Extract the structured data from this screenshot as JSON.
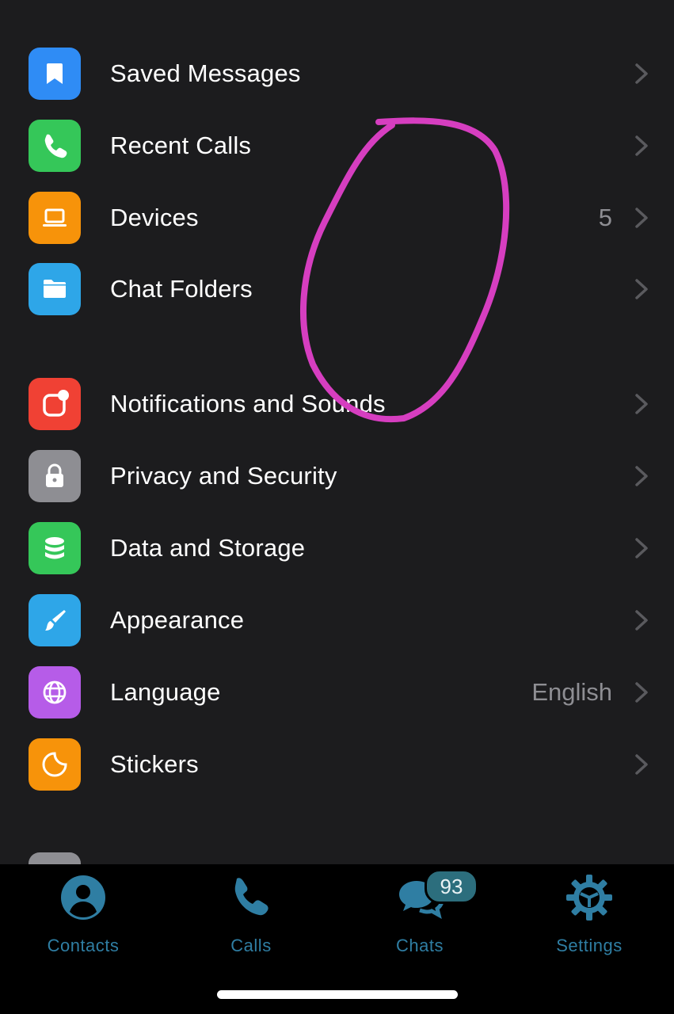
{
  "settings_list": {
    "group1": [
      {
        "label": "Saved Messages",
        "value": "",
        "icon": "bookmark-icon",
        "color": "#2f8cf5"
      },
      {
        "label": "Recent Calls",
        "value": "",
        "icon": "phone-icon",
        "color": "#35c759"
      },
      {
        "label": "Devices",
        "value": "5",
        "icon": "laptop-icon",
        "color": "#f7930a"
      },
      {
        "label": "Chat Folders",
        "value": "",
        "icon": "folder-icon",
        "color": "#2ea6e8"
      }
    ],
    "group2": [
      {
        "label": "Notifications and Sounds",
        "value": "",
        "icon": "notification-icon",
        "color": "#f04134"
      },
      {
        "label": "Privacy and Security",
        "value": "",
        "icon": "lock-icon",
        "color": "#8e8e93"
      },
      {
        "label": "Data and Storage",
        "value": "",
        "icon": "database-icon",
        "color": "#35c759"
      },
      {
        "label": "Appearance",
        "value": "",
        "icon": "brush-icon",
        "color": "#2ea6e8"
      },
      {
        "label": "Language",
        "value": "English",
        "icon": "globe-icon",
        "color": "#b65ce8"
      },
      {
        "label": "Stickers",
        "value": "",
        "icon": "sticker-icon",
        "color": "#f7930a"
      }
    ]
  },
  "tabbar": {
    "contacts": {
      "label": "Contacts",
      "icon": "person-icon"
    },
    "calls": {
      "label": "Calls",
      "icon": "phone-icon"
    },
    "chats": {
      "label": "Chats",
      "icon": "chat-bubbles-icon",
      "badge": "93"
    },
    "settings": {
      "label": "Settings",
      "icon": "gear-icon"
    }
  },
  "colors": {
    "background": "#1c1c1e",
    "tab_active": "#2f7ea3",
    "annotation": "#d63ec0"
  }
}
